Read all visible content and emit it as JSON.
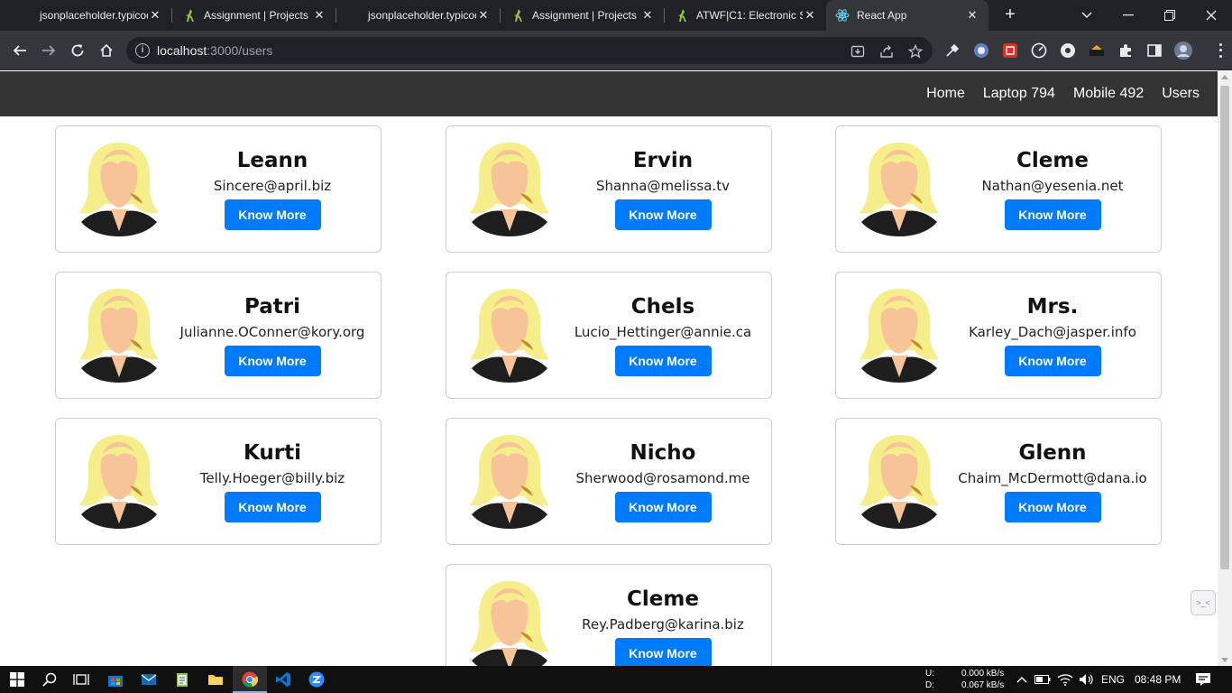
{
  "browser": {
    "tabs": [
      {
        "title": "jsonplaceholder.typicode.com",
        "icon": "blank"
      },
      {
        "title": "Assignment | Projects",
        "icon": "runner-icon"
      },
      {
        "title": "jsonplaceholder.typicode.com",
        "icon": "blank"
      },
      {
        "title": "Assignment | Projects",
        "icon": "runner-icon"
      },
      {
        "title": "ATWF|C1: Electronic S",
        "icon": "runner-icon"
      },
      {
        "title": "React App",
        "icon": "react-icon",
        "active": true
      }
    ],
    "address": {
      "host": "localhost",
      "path": ":3000/users"
    }
  },
  "nav": {
    "links": [
      "Home",
      "Laptop 794",
      "Mobile 492",
      "Users"
    ]
  },
  "users": [
    {
      "name": "Leann",
      "email": "Sincere@april.biz"
    },
    {
      "name": "Ervin",
      "email": "Shanna@melissa.tv"
    },
    {
      "name": "Cleme",
      "email": "Nathan@yesenia.net"
    },
    {
      "name": "Patri",
      "email": "Julianne.OConner@kory.org"
    },
    {
      "name": "Chels",
      "email": "Lucio_Hettinger@annie.ca"
    },
    {
      "name": "Mrs.",
      "email": "Karley_Dach@jasper.info"
    },
    {
      "name": "Kurti",
      "email": "Telly.Hoeger@billy.biz"
    },
    {
      "name": "Nicho",
      "email": "Sherwood@rosamond.me"
    },
    {
      "name": "Glenn",
      "email": "Chaim_McDermott@dana.io"
    },
    {
      "name": "Cleme",
      "email": "Rey.Padberg@karina.biz"
    }
  ],
  "card_button_label": "Know More",
  "colors": {
    "accent": "#007bff",
    "nav_bg": "#333333",
    "chrome_bg": "#202124"
  },
  "taskbar": {
    "upload_label": "U:",
    "upload_value": "0.000 kB/s",
    "download_label": "D:",
    "download_value": "0.067 kB/s",
    "language": "ENG",
    "time": "08:48 PM"
  }
}
